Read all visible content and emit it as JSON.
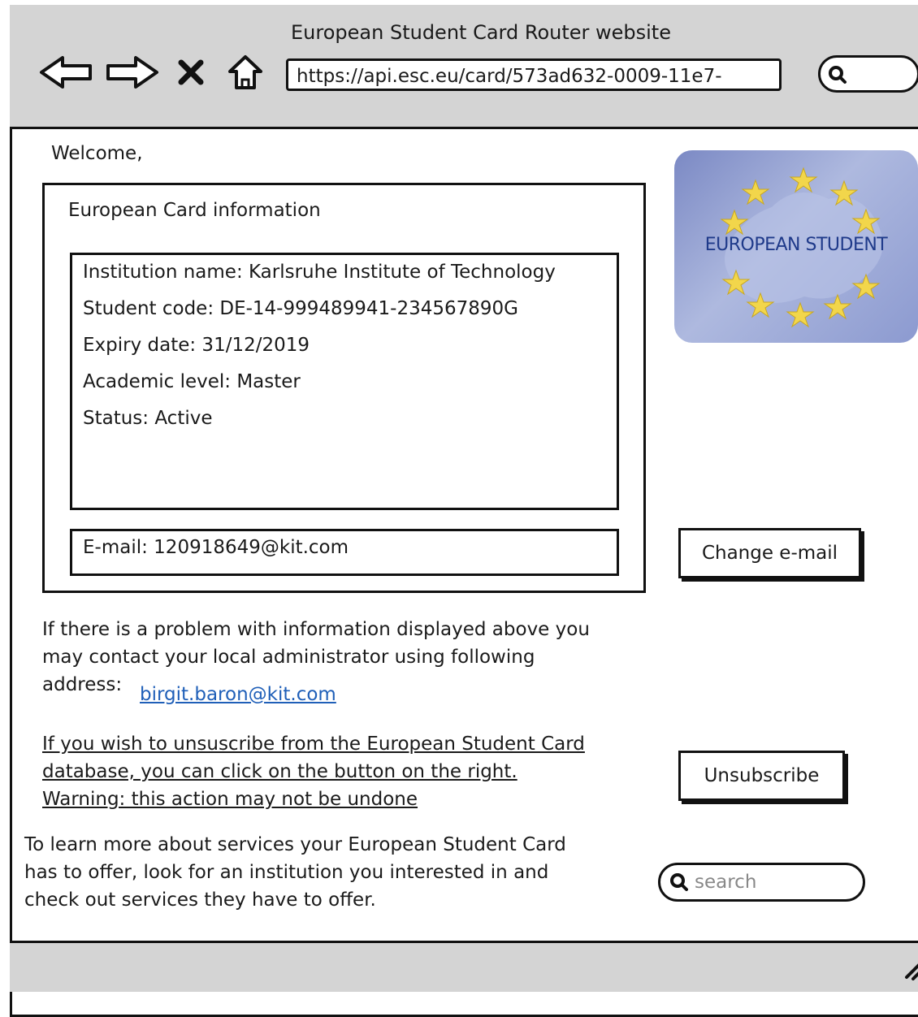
{
  "window": {
    "title": "European Student Card Router website"
  },
  "browser": {
    "url": "https://api.esc.eu/card/573ad632-0009-11e7-",
    "nav_icons": [
      "back-arrow-icon",
      "forward-arrow-icon",
      "stop-icon",
      "home-icon",
      "search-icon"
    ]
  },
  "page": {
    "welcome": "Welcome,",
    "card_section_title": "European Card information",
    "info": {
      "institution": "Institution name: Karlsruhe Institute of Technology",
      "student_code": "Student code: DE-14-999489941-234567890G",
      "expiry": "Expiry date: 31/12/2019",
      "level": "Academic level: Master",
      "status": "Status: Active"
    },
    "email": "E-mail: 120918649@kit.com",
    "change_email_button": "Change e-mail",
    "logo_text": "EUROPEAN STUDENT",
    "problem_text_1": "If there is a problem with information displayed above you",
    "problem_text_2": "may contact your local administrator using following",
    "problem_text_3": "address:",
    "admin_email": "birgit.baron@kit.com",
    "unsubscribe_text_1": "If you wish to unsuscribe from the European Student Card",
    "unsubscribe_text_2": "database, you can click on the button on the right.",
    "unsubscribe_text_3": "Warning: this action may not be undone",
    "unsubscribe_button": "Unsubscribe",
    "learn_text_1": "To learn more about services your European Student Card",
    "learn_text_2": "has to offer, look for an institution you interested in and",
    "learn_text_3": "check out services they have to offer.",
    "search_placeholder": "search"
  },
  "colors": {
    "chrome": "#d4d4d4",
    "link": "#1f5fb8",
    "logo_bg": "#8c9ad0",
    "star": "#f2d64b"
  }
}
